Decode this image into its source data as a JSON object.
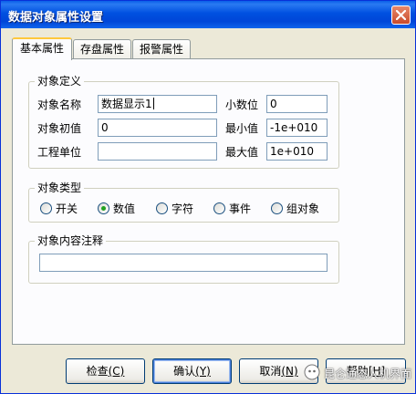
{
  "window": {
    "title": "数据对象属性设置"
  },
  "tabs": [
    {
      "label": "基本属性",
      "active": true
    },
    {
      "label": "存盘属性",
      "active": false
    },
    {
      "label": "报警属性",
      "active": false
    }
  ],
  "object_definition": {
    "legend": "对象定义",
    "name_label": "对象名称",
    "name_value": "数据显示1",
    "initial_label": "对象初值",
    "initial_value": "0",
    "unit_label": "工程单位",
    "unit_value": "",
    "decimal_label": "小数位",
    "decimal_value": "0",
    "min_label": "最小值",
    "min_value": "-1e+010",
    "max_label": "最大值",
    "max_value": "1e+010"
  },
  "object_type": {
    "legend": "对象类型",
    "options": [
      {
        "label": "开关",
        "selected": false
      },
      {
        "label": "数值",
        "selected": true
      },
      {
        "label": "字符",
        "selected": false
      },
      {
        "label": "事件",
        "selected": false
      },
      {
        "label": "组对象",
        "selected": false
      }
    ]
  },
  "comment": {
    "legend": "对象内容注释",
    "value": ""
  },
  "buttons": {
    "check_label": "检查",
    "check_key": "(C)",
    "confirm_label": "确认",
    "confirm_key": "(Y)",
    "cancel_label": "取消",
    "cancel_key": "(N)",
    "help_label": "帮助",
    "help_key": "[H]"
  },
  "watermark": {
    "text": "昆仑通态人机界面"
  },
  "colors": {
    "titlebar": "#0054e3",
    "dialog_bg": "#ece9d8",
    "active_tab_accent": "#ffc83c",
    "radio_selected": "#21a121"
  }
}
